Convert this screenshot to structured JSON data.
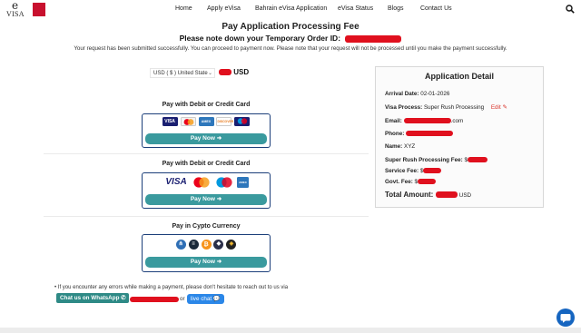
{
  "nav": {
    "logo_text_e": "e",
    "logo_text_visa": "VISA",
    "links": [
      "Home",
      "Apply eVisa",
      "Bahrain eVisa Application",
      "eVisa Status",
      "Blogs",
      "Contact Us"
    ]
  },
  "header": {
    "title": "Pay Application Processing Fee",
    "order_label": "Please note down your Temporary Order ID:",
    "info": "Your request has been submitted successfully. You can proceed to payment now. Please note that your request will not be processed until you make the payment successfully."
  },
  "currency": {
    "selected": "USD ( $ ) United State",
    "unit": "USD"
  },
  "payments": [
    {
      "heading": "Pay with Debit or Credit Card",
      "button": "Pay Now ➜",
      "logos": [
        "visa",
        "mastercard",
        "amex",
        "discover",
        "maestro"
      ]
    },
    {
      "heading": "Pay with Debit or Credit Card",
      "button": "Pay Now ➜",
      "logos": [
        "visa",
        "mastercard",
        "maestro",
        "amex"
      ]
    },
    {
      "heading": "Pay in Cypto Currency",
      "button": "Pay Now ➜",
      "logos": [
        "share",
        "layers",
        "bitcoin",
        "ethereum",
        "binance"
      ]
    }
  ],
  "detail": {
    "title": "Application Detail",
    "arrival_label": "Arrival Date:",
    "arrival_value": "02-01-2026",
    "process_label": "Visa Process:",
    "process_value": "Super Rush Processing",
    "edit_label": "Edit",
    "email_label": "Email:",
    "email_suffix": ".com",
    "phone_label": "Phone:",
    "name_label": "Name:",
    "name_value": "XYZ",
    "fee_label": "Super Rush Processing Fee:",
    "service_label": "Service Fee:",
    "govt_label": "Govt. Fee:",
    "currency_symbol": "$",
    "total_label": "Total Amount:",
    "total_unit": "USD"
  },
  "help": {
    "text": "If you encounter any errors while making a payment, please don't hesitate to reach out to us via",
    "whatsapp": "Chat us on WhatsApp",
    "or": "or",
    "live_chat": "live chat"
  },
  "colors": {
    "accent_teal": "#3a9a9e",
    "box_border": "#1c3f7a",
    "redaction": "#e0101e",
    "live_chat_blue": "#2b87e8",
    "chat_fab": "#1565c0"
  }
}
